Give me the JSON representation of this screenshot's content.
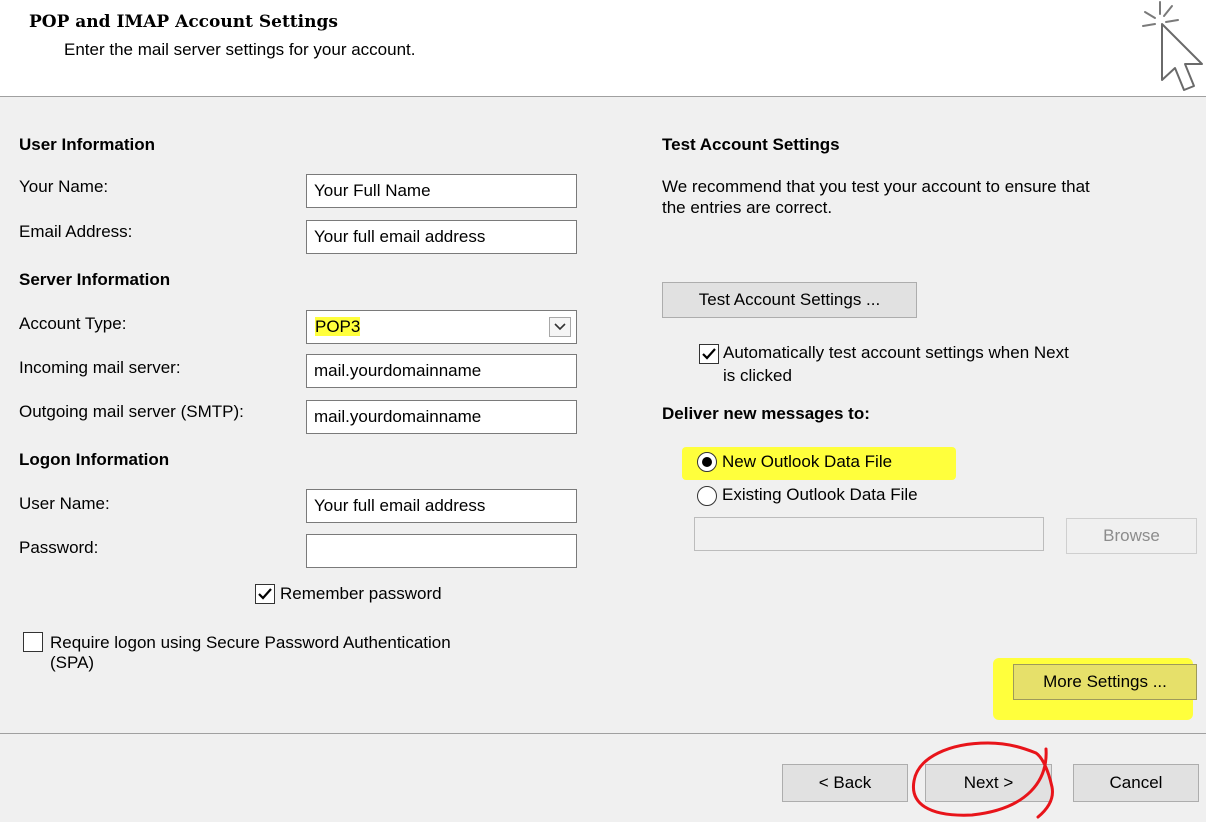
{
  "header": {
    "title": "POP and IMAP Account Settings",
    "subtitle": "Enter the mail server settings for your account.",
    "icon": "wizard-cursor-icon"
  },
  "user_information": {
    "heading": "User Information",
    "your_name_label": "Your Name:",
    "your_name_value": "Your Full Name",
    "email_label": "Email Address:",
    "email_value": "Your full email address"
  },
  "server_information": {
    "heading": "Server Information",
    "account_type_label": "Account Type:",
    "account_type_value": "POP3",
    "incoming_label": "Incoming mail server:",
    "incoming_value": "mail.yourdomainname",
    "outgoing_label": "Outgoing mail server (SMTP):",
    "outgoing_value": "mail.yourdomainname"
  },
  "logon_information": {
    "heading": "Logon Information",
    "username_label": "User Name:",
    "username_value": "Your full email address",
    "password_label": "Password:",
    "password_value": "",
    "remember_password_label": "Remember password",
    "remember_password_checked": true,
    "spa_label_line1": "Require logon using Secure Password Authentication",
    "spa_label_line2": "(SPA)",
    "spa_checked": false
  },
  "test_account": {
    "heading": "Test Account Settings",
    "description_line1": "We recommend that you test your account to ensure that",
    "description_line2": "the entries are correct.",
    "test_button_label": "Test Account Settings ...",
    "auto_test_label_line1": "Automatically test account settings when Next",
    "auto_test_label_line2": "is clicked",
    "auto_test_checked": true
  },
  "deliver": {
    "heading": "Deliver new messages to:",
    "option_new_label": "New Outlook Data File",
    "option_existing_label": "Existing Outlook Data File",
    "selected": "new",
    "existing_path_value": "",
    "browse_label": "Browse"
  },
  "more_settings_label": "More Settings ...",
  "footer": {
    "back_label": "< Back",
    "next_label": "Next >",
    "cancel_label": "Cancel"
  },
  "colors": {
    "highlight": "#ffff3c",
    "annotation_circle": "#e8141a",
    "dialog_bg": "#f0f0f0"
  }
}
